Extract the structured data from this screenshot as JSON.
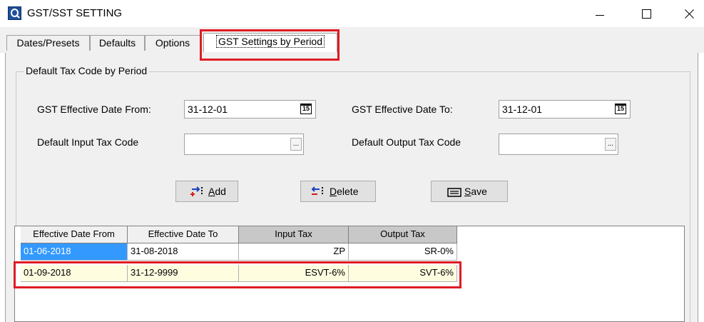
{
  "window": {
    "title": "GST/SST SETTING"
  },
  "tabs": [
    {
      "label": "Dates/Presets"
    },
    {
      "label": "Defaults"
    },
    {
      "label": "Options"
    },
    {
      "label": "GST Settings by Period",
      "active": true
    }
  ],
  "group": {
    "label": "Default Tax Code by Period"
  },
  "form": {
    "date_from_label": "GST Effective Date From:",
    "date_from_value": "31-12-01",
    "date_to_label": "GST Effective Date To:",
    "date_to_value": "31-12-01",
    "input_tax_label": "Default Input Tax Code",
    "input_tax_value": "",
    "output_tax_label": "Default Output Tax Code",
    "output_tax_value": "",
    "calendar_icon_text": "15",
    "ellipsis_text": "..."
  },
  "buttons": {
    "add_accel": "A",
    "add_rest": "dd",
    "delete_accel": "D",
    "delete_rest": "elete",
    "save_accel": "S",
    "save_rest": "ave"
  },
  "grid": {
    "columns": [
      "Effective Date From",
      "Effective Date To",
      "Input Tax",
      "Output Tax"
    ],
    "rows": [
      {
        "from": "01-06-2018",
        "to": "31-08-2018",
        "input": "ZP",
        "output": "SR-0%"
      },
      {
        "from": "01-09-2018",
        "to": "31-12-9999",
        "input": "ESVT-6%",
        "output": "SVT-6%"
      }
    ]
  },
  "colors": {
    "highlight": "#e01b24",
    "selection": "#3399ff",
    "row_highlight_bg": "#fffde0"
  },
  "icons": [
    "app-icon",
    "minimize-icon",
    "maximize-icon",
    "close-icon",
    "calendar-icon",
    "ellipsis-icon",
    "add-row-icon",
    "delete-row-icon",
    "save-icon"
  ]
}
